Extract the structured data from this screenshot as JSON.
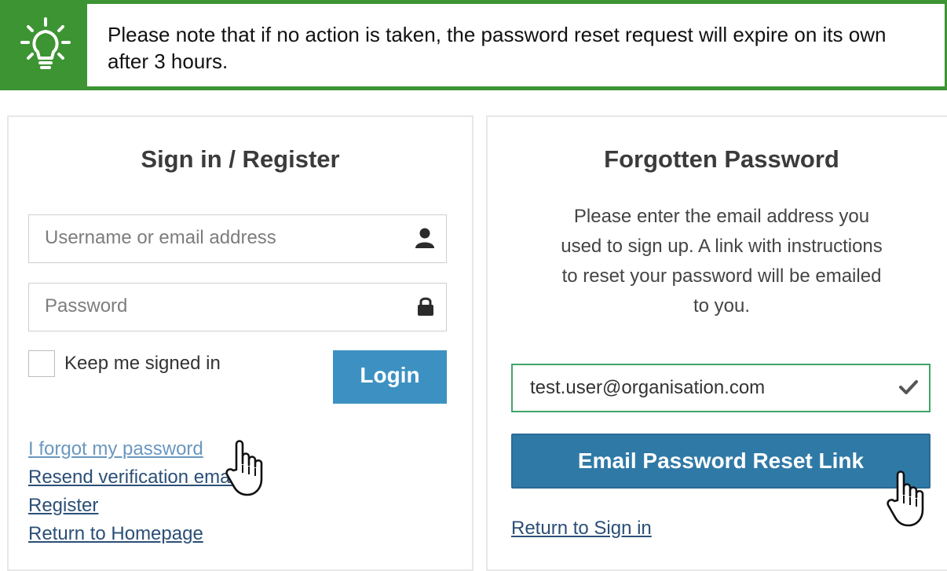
{
  "tip": {
    "icon": "lightbulb-icon",
    "text": "Please note that if no action is taken, the password reset request will expire on its own after 3 hours.",
    "color": "#3c9432"
  },
  "signin": {
    "title": "Sign in / Register",
    "username_placeholder": "Username or email address",
    "username_icon": "user-icon",
    "password_placeholder": "Password",
    "password_icon": "lock-icon",
    "keep_signed_in_label": "Keep me signed in",
    "keep_signed_in_checked": false,
    "login_label": "Login",
    "links": {
      "forgot": "I forgot my password",
      "resend": "Resend verification email",
      "register": "Register",
      "homepage": "Return to Homepage"
    }
  },
  "forgot": {
    "title": "Forgotten Password",
    "description_lines": [
      "Please enter the email address you",
      "used to sign up. A link with instructions",
      "to reset your password will be emailed",
      "to you."
    ],
    "email_value": "test.user@organisation.com",
    "email_status_icon": "checkmark-icon",
    "reset_button_label": "Email Password Reset Link",
    "return_link": "Return to Sign in"
  },
  "colors": {
    "accent_green": "#3c9432",
    "login_blue": "#3d91c2",
    "reset_blue": "#2f79a6",
    "valid_border": "#3ea568",
    "link": "#2b4f77"
  }
}
